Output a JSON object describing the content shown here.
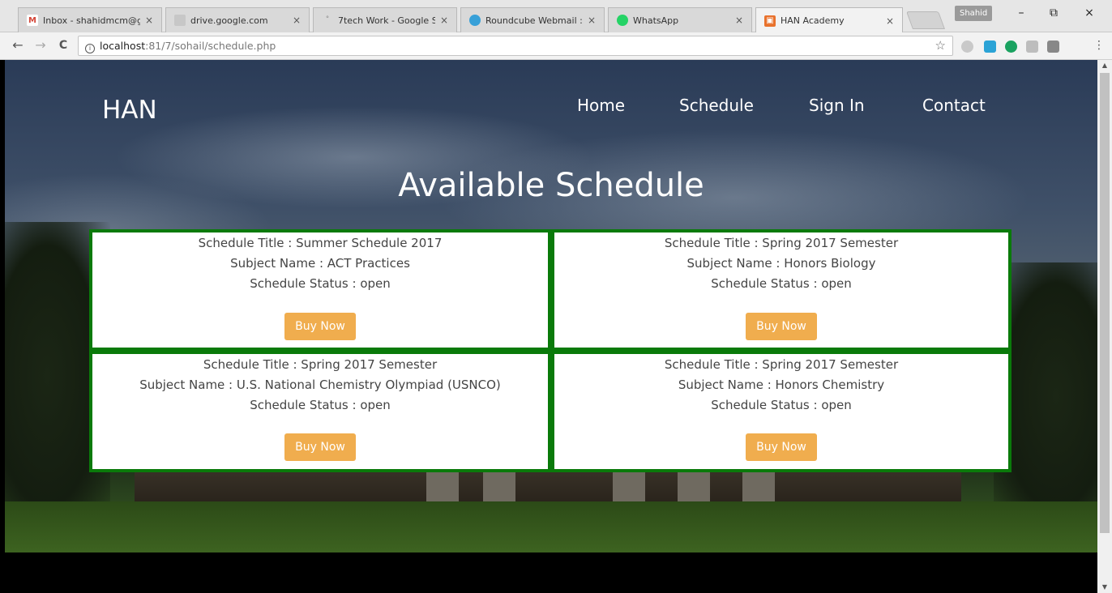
{
  "browser": {
    "tabs": [
      {
        "label": "Inbox - shahidmcm@g",
        "icon": "gmail-icon",
        "color": "#d44638"
      },
      {
        "label": "drive.google.com",
        "icon": "drive-icon",
        "color": "#9aa0a6"
      },
      {
        "label": "7tech Work - Google S",
        "icon": "sheets-icon",
        "color": "#c9c9c9"
      },
      {
        "label": "Roundcube Webmail ::",
        "icon": "roundcube-icon",
        "color": "#37a0d8"
      },
      {
        "label": "WhatsApp",
        "icon": "whatsapp-icon",
        "color": "#25d366"
      },
      {
        "label": "HAN Academy",
        "icon": "han-favicon",
        "color": "#e8712c"
      }
    ],
    "close_glyph": "×",
    "profile_name": "Shahid",
    "window_controls": {
      "minimize": "–",
      "restore": "⧉",
      "close": "×"
    },
    "nav": {
      "back": "←",
      "forward": "→",
      "reload": "C"
    },
    "url": {
      "host": "localhost",
      "path": ":81/7/sohail/schedule.php"
    }
  },
  "site": {
    "brand": "HAN",
    "nav": [
      "Home",
      "Schedule",
      "Sign In",
      "Contact"
    ],
    "heading": "Available Schedule",
    "cards": [
      {
        "title": "Schedule Title : Summer Schedule 2017",
        "subject": "Subject Name : ACT Practices",
        "status": "Schedule Status : open",
        "button": "Buy Now"
      },
      {
        "title": "Schedule Title : Spring 2017 Semester",
        "subject": "Subject Name : Honors Biology",
        "status": "Schedule Status : open",
        "button": "Buy Now"
      },
      {
        "title": "Schedule Title : Spring 2017 Semester",
        "subject": "Subject Name : U.S. National Chemistry Olympiad (USNCO)",
        "status": "Schedule Status : open",
        "button": "Buy Now"
      },
      {
        "title": "Schedule Title : Spring 2017 Semester",
        "subject": "Subject Name : Honors Chemistry",
        "status": "Schedule Status : open",
        "button": "Buy Now"
      }
    ],
    "colors": {
      "card_border": "#0a7a0a",
      "button": "#f0ad4e"
    }
  }
}
